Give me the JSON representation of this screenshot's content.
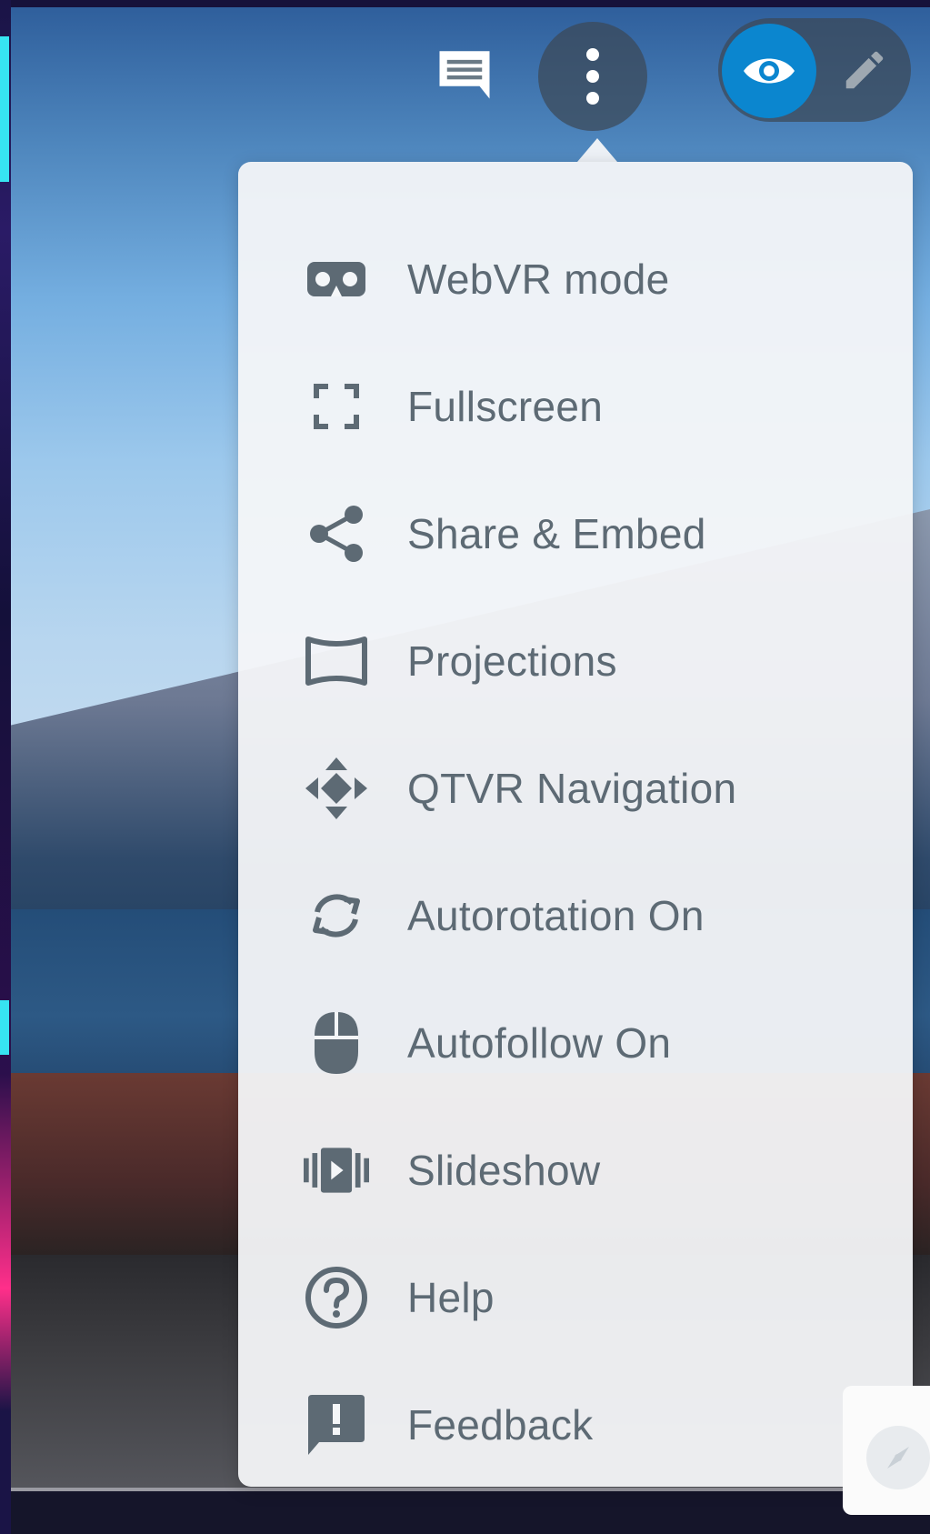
{
  "toolbar": {
    "comments_icon": "comment-icon",
    "more_icon": "more-vertical-icon",
    "view_mode_icon": "eye-icon",
    "edit_mode_icon": "pencil-icon"
  },
  "menu": {
    "items": [
      {
        "label": "WebVR mode",
        "icon": "vr-goggles-icon"
      },
      {
        "label": "Fullscreen",
        "icon": "fullscreen-icon"
      },
      {
        "label": "Share & Embed",
        "icon": "share-icon"
      },
      {
        "label": "Projections",
        "icon": "projection-icon"
      },
      {
        "label": "QTVR Navigation",
        "icon": "move-arrows-icon"
      },
      {
        "label": "Autorotation On",
        "icon": "autorotate-icon"
      },
      {
        "label": "Autofollow On",
        "icon": "mouse-icon"
      },
      {
        "label": "Slideshow",
        "icon": "slideshow-icon"
      },
      {
        "label": "Help",
        "icon": "help-icon"
      },
      {
        "label": "Feedback",
        "icon": "feedback-icon"
      }
    ]
  },
  "compass": {
    "icon": "compass-icon"
  },
  "colors": {
    "accent": "#0b86cf",
    "menu_text": "#5d6a74",
    "menu_bg": "#f4f6f8",
    "toolbar_bg": "#3c4856"
  }
}
